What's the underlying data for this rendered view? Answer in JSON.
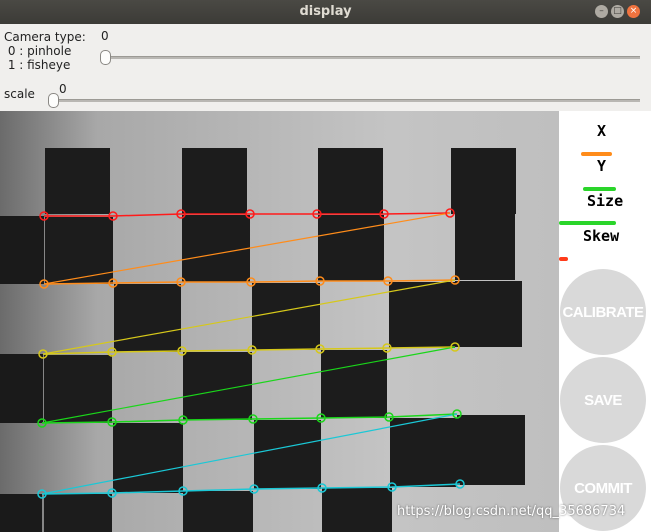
{
  "window": {
    "title": "display"
  },
  "controls": {
    "camera_type_label": "Camera type:\n 0 : pinhole\n 1 : fisheye",
    "camera_type_value": "0",
    "camera_type_level": 0,
    "scale_label": "scale",
    "scale_value": "0",
    "scale_level": 0
  },
  "legend": {
    "x_label": "X",
    "y_label": "Y",
    "size_label": "Size",
    "skew_label": "Skew",
    "x_level": 0.34,
    "y_level": 0.36,
    "size_level": 0.62,
    "skew_level": 0.1,
    "colors": {
      "x": "#ff8c1a",
      "y": "#2ad52a",
      "size": "#2ad52a",
      "skew": "#ff3b1a"
    }
  },
  "buttons": {
    "calibrate": "CALIBRATE",
    "save": "SAVE",
    "commit": "COMMIT"
  },
  "watermark": "https://blog.csdn.net/qq_35686734",
  "corner_colors": [
    "#ff1a1a",
    "#ff8c1a",
    "#d6c81a",
    "#1ad61a",
    "#1ac8d6"
  ]
}
